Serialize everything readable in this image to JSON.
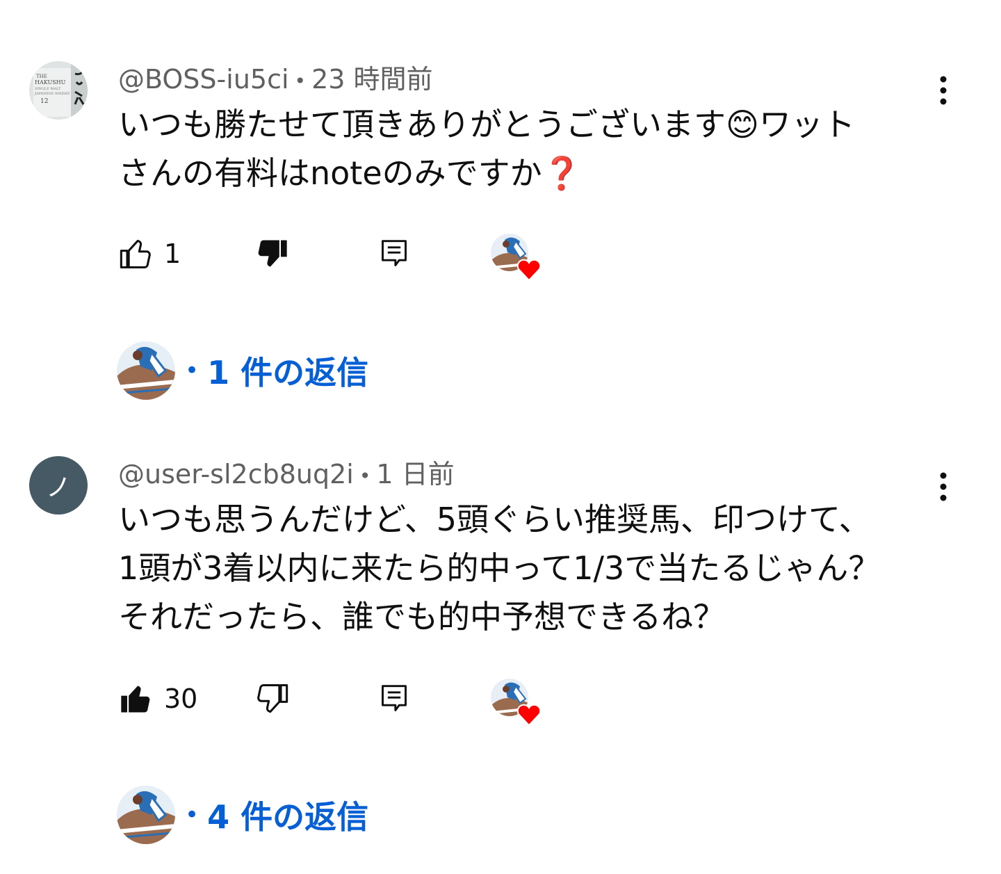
{
  "comments": [
    {
      "author": "@BOSS-iu5ci",
      "time": "23 時間前",
      "text_lines": [
        "いつも勝たせて頂きありがとうございます😊ワット",
        "さんの有料はnoteのみですか❓"
      ],
      "like_count": "1",
      "liked": false,
      "disliked": true,
      "avatar_icon": "whisky-bottle-avatar",
      "replies_label": "1 件の返信"
    },
    {
      "author": "@user-sl2cb8uq2i",
      "time": "1 日前",
      "avatar_letter": "ノ",
      "avatar_color": "#455a64",
      "text_lines": [
        "いつも思うんだけど、5頭ぐらい推奨馬、印つけて、",
        "1頭が3着以内に来たら的中って1/3で当たるじゃん？",
        "それだったら、誰でも的中予想できるね？"
      ],
      "like_count": "30",
      "liked": true,
      "disliked": false,
      "replies_label": "4 件の返信"
    }
  ],
  "colors": {
    "link": "#065fd4",
    "meta": "#606060",
    "heart": "#ff0000"
  }
}
